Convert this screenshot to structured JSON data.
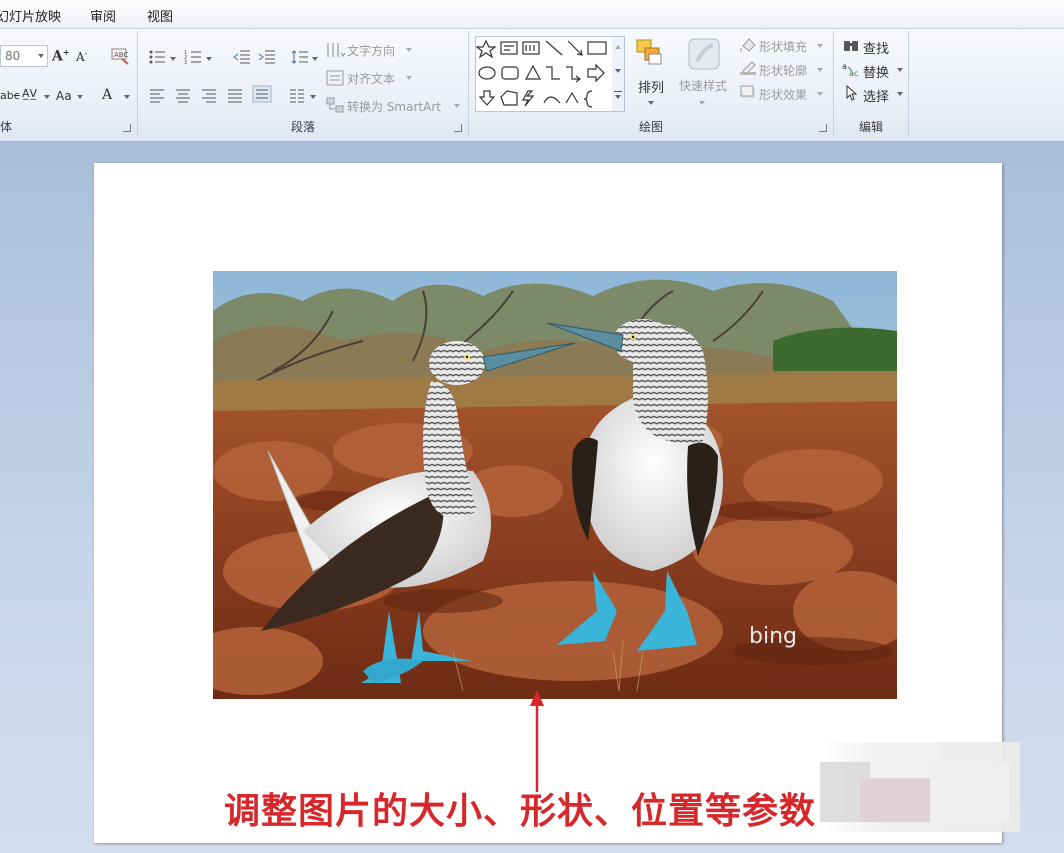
{
  "menubar": {
    "items": [
      "幻灯片放映",
      "审阅",
      "视图"
    ]
  },
  "ribbon": {
    "font": {
      "size_value": "80",
      "label": "体"
    },
    "paragraph": {
      "text_direction": "文字方向",
      "align_text": "对齐文本",
      "convert_smartart": "转换为 SmartArt",
      "label": "段落"
    },
    "drawing": {
      "arrange": "排列",
      "quick_styles": "快速样式",
      "shape_fill": "形状填充",
      "shape_outline": "形状轮廓",
      "shape_effects": "形状效果",
      "label": "绘图"
    },
    "editing": {
      "find": "查找",
      "replace": "替换",
      "select": "选择",
      "label": "编辑"
    }
  },
  "slide": {
    "watermark": "bing",
    "caption": "调整图片的大小、形状、位置等参数"
  },
  "colors": {
    "caption": "#d6282b",
    "ribbon_bg": "#e9eef6",
    "workspace_bg": "#b9cde4"
  }
}
